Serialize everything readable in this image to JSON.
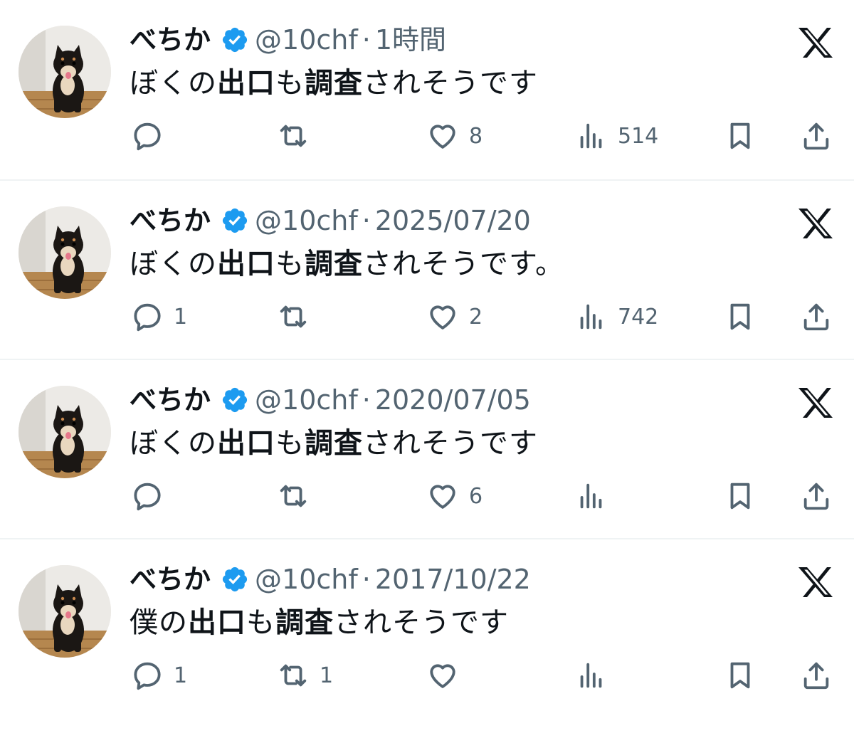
{
  "accent": "#1d9bf0",
  "muted_color": "#536471",
  "tweets": [
    {
      "name": "べちか",
      "handle": "@10chf",
      "sep": "·",
      "time": "1時間",
      "text": [
        {
          "t": "ぼくの",
          "b": false
        },
        {
          "t": "出口",
          "b": true
        },
        {
          "t": "も",
          "b": false
        },
        {
          "t": "調査",
          "b": true
        },
        {
          "t": "されそうです",
          "b": false
        }
      ],
      "replies": "",
      "retweets": "",
      "likes": "8",
      "views": "514"
    },
    {
      "name": "べちか",
      "handle": "@10chf",
      "sep": "·",
      "time": "2025/07/20",
      "text": [
        {
          "t": "ぼくの",
          "b": false
        },
        {
          "t": "出口",
          "b": true
        },
        {
          "t": "も",
          "b": false
        },
        {
          "t": "調査",
          "b": true
        },
        {
          "t": "されそうです。",
          "b": false
        }
      ],
      "replies": "1",
      "retweets": "",
      "likes": "2",
      "views": "742"
    },
    {
      "name": "べちか",
      "handle": "@10chf",
      "sep": "·",
      "time": "2020/07/05",
      "text": [
        {
          "t": "ぼくの",
          "b": false
        },
        {
          "t": "出口",
          "b": true
        },
        {
          "t": "も",
          "b": false
        },
        {
          "t": "調査",
          "b": true
        },
        {
          "t": "されそうです",
          "b": false
        }
      ],
      "replies": "",
      "retweets": "",
      "likes": "6",
      "views": ""
    },
    {
      "name": "べちか",
      "handle": "@10chf",
      "sep": "·",
      "time": "2017/10/22",
      "text": [
        {
          "t": "僕の",
          "b": false
        },
        {
          "t": "出口",
          "b": true
        },
        {
          "t": "も",
          "b": false
        },
        {
          "t": "調査",
          "b": true
        },
        {
          "t": "されそうです",
          "b": false
        }
      ],
      "replies": "1",
      "retweets": "1",
      "likes": "",
      "views": ""
    }
  ],
  "icons": {
    "avatar": "shiba-dog-avatar",
    "verified": "verified-badge-icon",
    "grok": "x-logo-icon",
    "reply": "reply-icon",
    "retweet": "retweet-icon",
    "like": "heart-icon",
    "views": "views-icon",
    "bookmark": "bookmark-icon",
    "share": "share-icon"
  }
}
